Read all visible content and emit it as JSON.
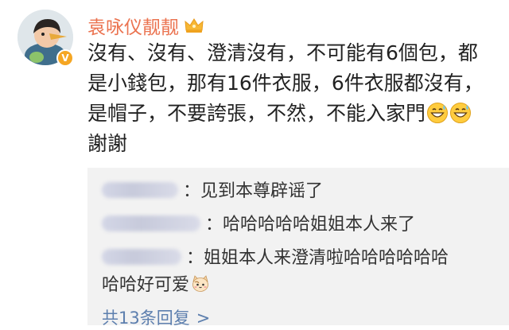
{
  "user": {
    "name": "袁咏仪靓靓",
    "badge_symbol": "V",
    "name_color": "#eb7350"
  },
  "post": {
    "lines": [
      "沒有、沒有、澄清沒有，不可能有6個包，都",
      "是小錢包，那有16件衣服，6件衣服都沒有，",
      "是帽子，不要誇張，不然，不能入家門",
      "謝謝"
    ],
    "emojis": [
      "grinning-sweat-emoji",
      "grinning-sweat-emoji"
    ]
  },
  "replies": [
    {
      "text": "见到本尊辟谣了",
      "separator": "："
    },
    {
      "text": "哈哈哈哈哈姐姐本人来了",
      "separator": "："
    },
    {
      "text_line1": "姐姐本人来澄清啦哈哈哈哈哈哈",
      "text_line2": "哈哈好可爱",
      "separator": "：",
      "emoji": "cat-face-emoji"
    }
  ],
  "more": {
    "label": "共13条回复",
    "chevron": ">",
    "link_color": "#5d7fae"
  }
}
